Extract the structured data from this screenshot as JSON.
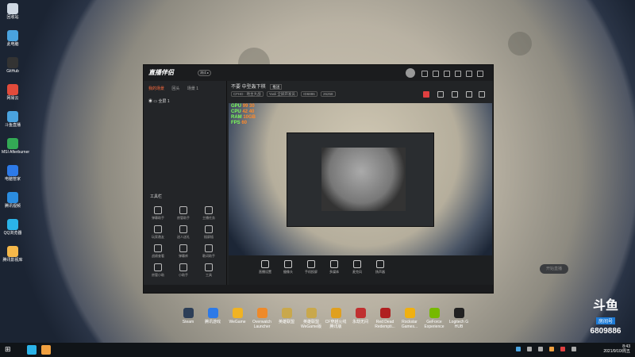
{
  "desktop_icons": [
    {
      "label": "回收站",
      "color": "#cfd8e3"
    },
    {
      "label": "此电脑",
      "color": "#4aa3df"
    },
    {
      "label": "GitHub",
      "color": "#333333"
    },
    {
      "label": "网易云",
      "color": "#e14b3b"
    },
    {
      "label": "斗鱼直播",
      "color": "#4aa3df"
    },
    {
      "label": "MSI Afterburner",
      "color": "#33aa55"
    },
    {
      "label": "电脑管家",
      "color": "#2d7ae8"
    },
    {
      "label": "腾讯视频",
      "color": "#2b8de0"
    },
    {
      "label": "QQ浏览器",
      "color": "#2bb3e8"
    },
    {
      "label": "腾讯影视库",
      "color": "#f5b84a"
    }
  ],
  "window": {
    "logo": "直播伴侣",
    "logo_badge": "测试 ▸",
    "tabs": [
      "我的场景",
      "回头",
      "场景 1"
    ],
    "scene_item": "全屏 1",
    "tools_title": "工具栏",
    "tools": [
      "弹幕助手",
      "房管助手",
      "主播任务",
      "玩家邀友",
      "送人送礼",
      "插屏插",
      "战绩查看",
      "弹幕库",
      "歌词助手",
      "房管小助",
      "小助手",
      "工具"
    ],
    "footer_hint": "如何用手机助手帮助主播上？",
    "room_title": "不要 中型轰下棋",
    "room_tag": "推送",
    "room_meta": [
      "CFHD · 地主大战",
      "Yasli 全屏开发员",
      "ID6886",
      "26258"
    ],
    "hud_lines": [
      {
        "label": "GPU",
        "value": "99",
        "value2": "30"
      },
      {
        "label": "CPU",
        "value": "42",
        "value2": "40"
      },
      {
        "label": "RAM",
        "value": "10GB",
        "value2": ""
      },
      {
        "label": "FPS",
        "value": "60",
        "value2": ""
      }
    ],
    "controls": [
      "直播设置",
      "摄像头",
      "手机投屏",
      "多媒体",
      "麦克风",
      "扬声器"
    ],
    "start_button": "开始直播"
  },
  "desktop_apps": [
    {
      "label": "Steam",
      "color": "#2c3e57"
    },
    {
      "label": "腾讯游戏",
      "color": "#2d7ae8"
    },
    {
      "label": "WeGame",
      "color": "#f0b323"
    },
    {
      "label": "Overwatch Launcher",
      "color": "#ee8a2a"
    },
    {
      "label": "英雄联盟",
      "color": "#c9a84c"
    },
    {
      "label": "英雄联盟 WeGame版",
      "color": "#c9a84c"
    },
    {
      "label": "CF穿越火线 腾讯版",
      "color": "#e0a020"
    },
    {
      "label": "永劫无间",
      "color": "#c03030"
    },
    {
      "label": "Red Dead Redempti...",
      "color": "#b02020"
    },
    {
      "label": "Rockstar Games...",
      "color": "#f0b010"
    },
    {
      "label": "GeForce Experience",
      "color": "#76b900"
    },
    {
      "label": "Logitech G HUB",
      "color": "#222222"
    }
  ],
  "douyu": {
    "brand": "斗鱼",
    "room_label": "房间号",
    "room_number": "6809886"
  },
  "taskbar": {
    "time": "8:43",
    "date": "2021/9/10/周五"
  }
}
